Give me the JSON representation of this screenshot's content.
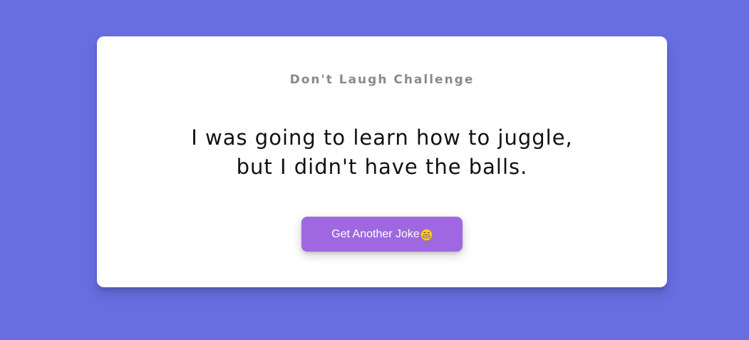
{
  "card": {
    "title": "Don't Laugh Challenge",
    "joke": "I was going to learn how to juggle, but I didn't have the balls.",
    "button_label": "Get Another Joke",
    "button_icon": "grinning-face-with-teeth-icon"
  },
  "colors": {
    "background": "#686de0",
    "card": "#ffffff",
    "title": "#8a8a8a",
    "joke_text": "#111111",
    "button": "#9f68e0",
    "button_text": "#ffffff",
    "emoji_face": "#ffcc33"
  }
}
